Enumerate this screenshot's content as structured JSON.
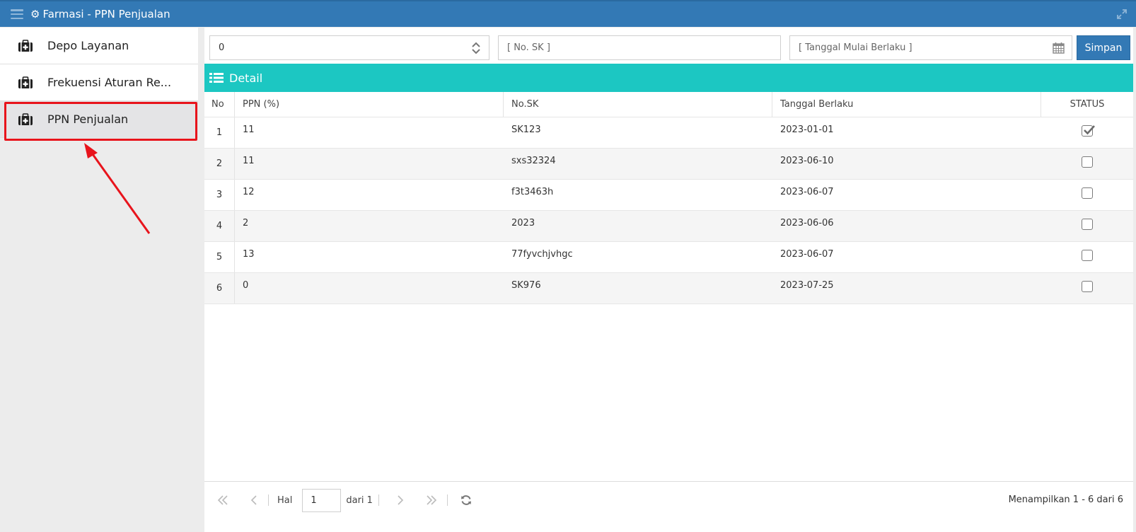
{
  "window": {
    "title": "Farmasi - PPN Penjualan"
  },
  "sidebar": {
    "items": [
      {
        "label": "Depo Layanan",
        "icon": "medical-kit-icon"
      },
      {
        "label": "Frekuensi Aturan Re...",
        "icon": "medical-kit-icon"
      },
      {
        "label": "PPN Penjualan",
        "icon": "medical-kit-icon",
        "active": true
      }
    ]
  },
  "form": {
    "ppn_value": "0",
    "sk_placeholder": "[ No. SK ]",
    "tanggal_placeholder": "[ Tanggal Mulai Berlaku ]",
    "save_label": "Simpan"
  },
  "detail": {
    "title": "Detail",
    "columns": [
      "No",
      "PPN (%)",
      "No.SK",
      "Tanggal Berlaku",
      "STATUS"
    ],
    "rows": [
      {
        "no": "1",
        "ppn": "11",
        "sk": "SK123",
        "tanggal": "2023-01-01",
        "status": true
      },
      {
        "no": "2",
        "ppn": "11",
        "sk": "sxs32324",
        "tanggal": "2023-06-10",
        "status": false
      },
      {
        "no": "3",
        "ppn": "12",
        "sk": "f3t3463h",
        "tanggal": "2023-06-07",
        "status": false
      },
      {
        "no": "4",
        "ppn": "2",
        "sk": "2023",
        "tanggal": "2023-06-06",
        "status": false
      },
      {
        "no": "5",
        "ppn": "13",
        "sk": "77fyvchjvhgc",
        "tanggal": "2023-06-07",
        "status": false
      },
      {
        "no": "6",
        "ppn": "0",
        "sk": "SK976",
        "tanggal": "2023-07-25",
        "status": false
      }
    ]
  },
  "pager": {
    "page_label": "Hal",
    "page_value": "1",
    "of_label": "dari 1",
    "summary": "Menampilkan 1 - 6 dari 6"
  },
  "colors": {
    "header_blue": "#3379b5",
    "detail_teal": "#1cc7c2",
    "highlight_red": "#e8141c"
  }
}
